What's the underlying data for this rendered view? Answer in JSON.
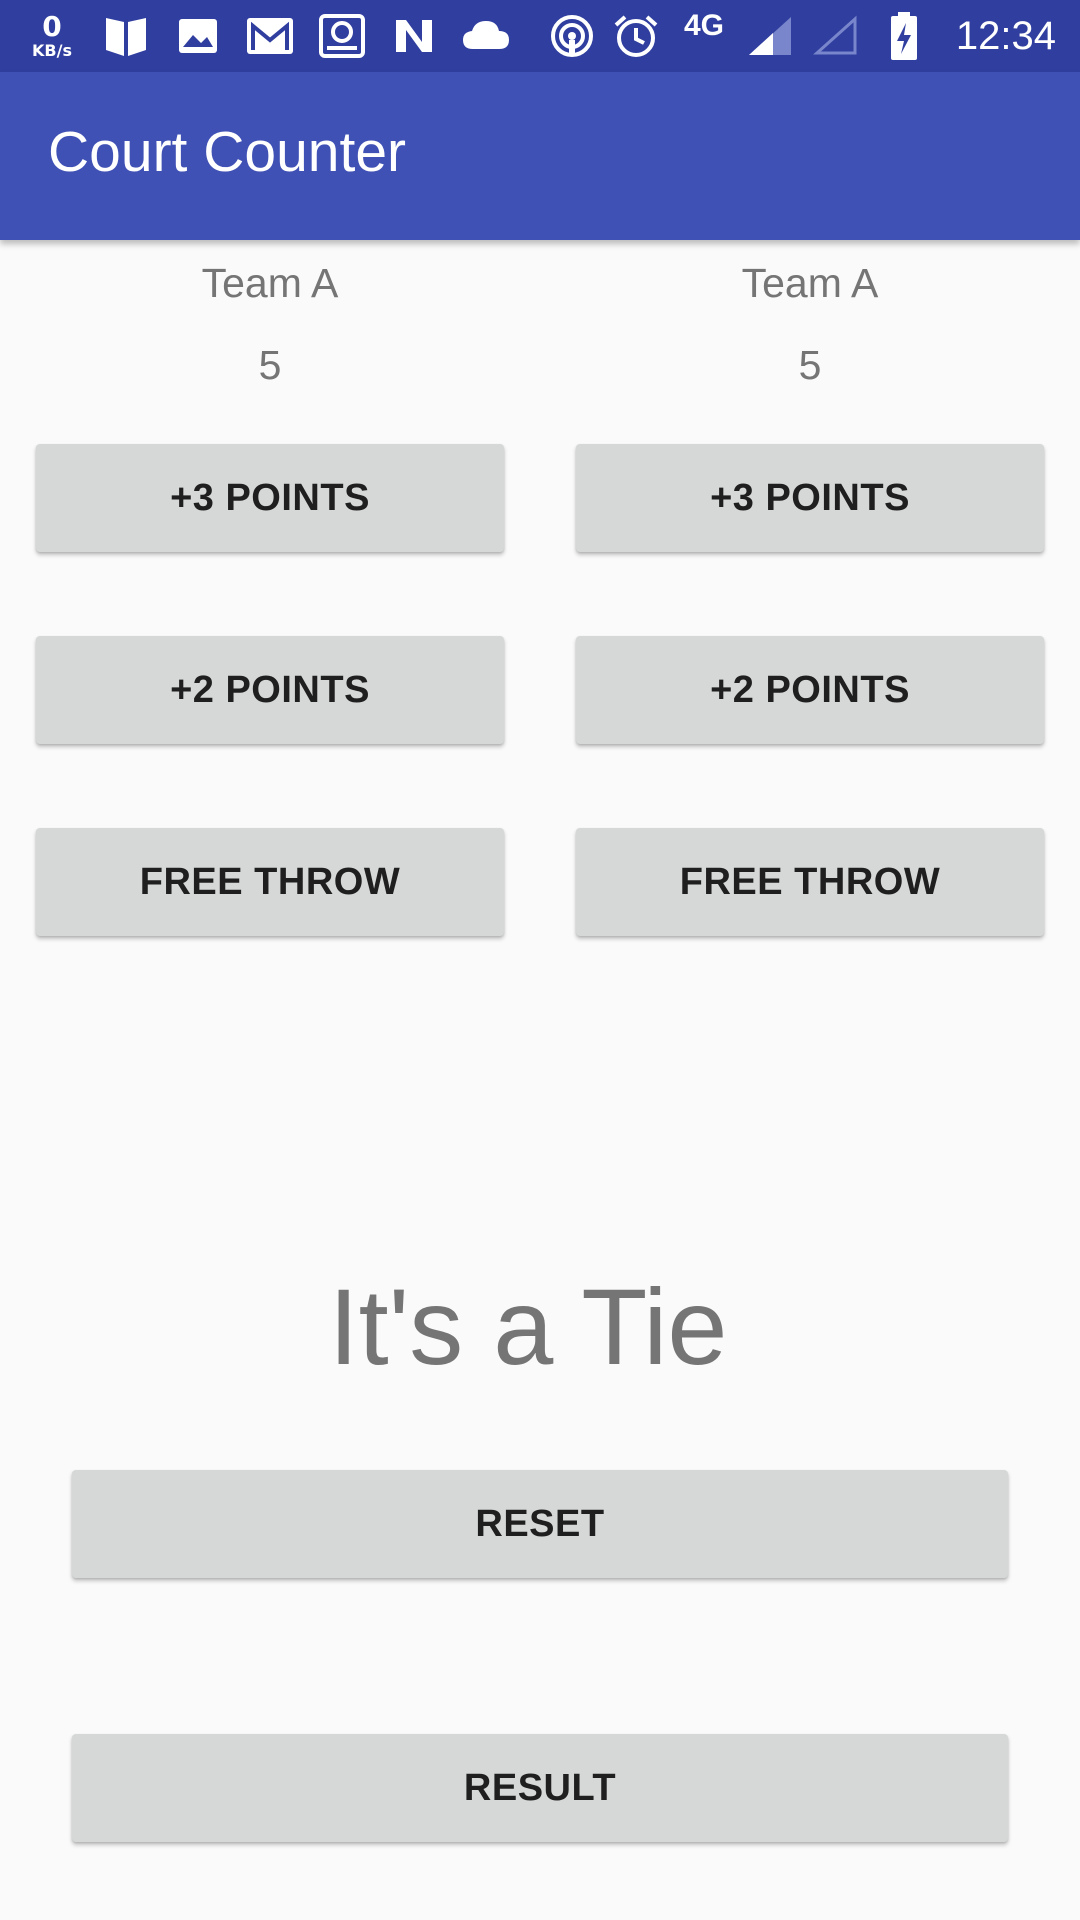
{
  "status_bar": {
    "net_speed_value": "0",
    "net_speed_unit": "KB/s",
    "network_type": "4G",
    "time": "12:34"
  },
  "app_bar": {
    "title": "Court Counter",
    "color": "#3f51b5"
  },
  "team_a": {
    "name": "Team A",
    "score": "5",
    "btn_three": "+3 POINTS",
    "btn_two": "+2 POINTS",
    "btn_free": "FREE THROW"
  },
  "team_b": {
    "name": "Team A",
    "score": "5",
    "btn_three": "+3 POINTS",
    "btn_two": "+2 POINTS",
    "btn_free": "FREE THROW"
  },
  "result_text": "It's a Tie",
  "reset_label": "RESET",
  "result_label": "RESULT"
}
